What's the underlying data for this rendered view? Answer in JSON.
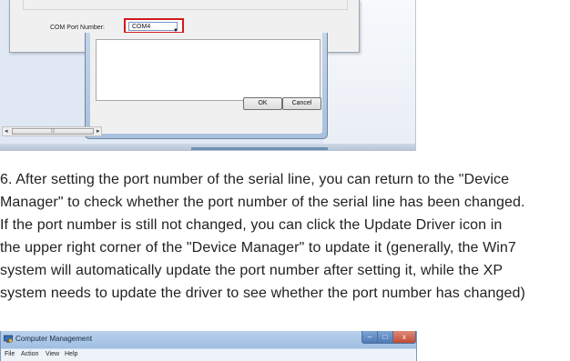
{
  "top_screenshot": {
    "com_port": {
      "label": "COM Port Number:",
      "selected_value": "COM4",
      "highlight_color": "#d11a1a"
    },
    "buttons": {
      "ok_label": "OK",
      "cancel_label": "Cancel"
    },
    "scrollbar": {
      "left_arrow": "◂",
      "right_arrow": "▸",
      "thumb_grip": "|||"
    }
  },
  "paragraph": {
    "lines": [
      "6. After setting the port number of the serial line, you can return to the \"Device",
      "Manager\" to check whether the port number of the serial line has been changed.",
      "If the port number is still not changed, you can click the Update Driver icon in",
      "the upper right corner of the \"Device Manager\" to update it (generally, the Win7",
      "system will automatically update the port number after setting it, while the XP",
      "system needs to update the driver to see whether the port number has changed)"
    ]
  },
  "bottom_screenshot": {
    "window_title": "Computer Management",
    "window_buttons": {
      "minimize": "‒",
      "maximize": "□",
      "close": "x"
    },
    "menu": [
      "File",
      "Action",
      "View",
      "Help"
    ]
  }
}
